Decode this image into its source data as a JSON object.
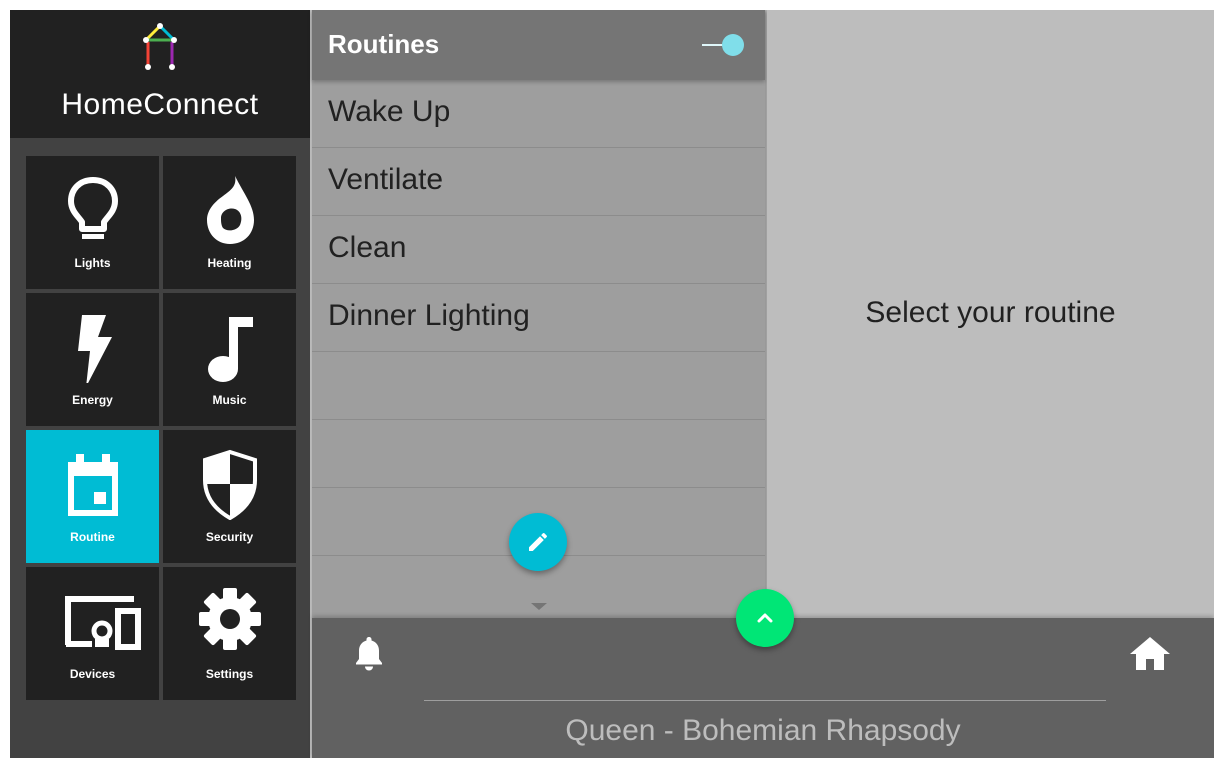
{
  "app": {
    "name": "HomeConnect"
  },
  "sidebar": {
    "tiles": [
      {
        "label": "Lights",
        "icon": "lightbulb-icon"
      },
      {
        "label": "Heating",
        "icon": "flame-icon"
      },
      {
        "label": "Energy",
        "icon": "lightning-bolt-icon"
      },
      {
        "label": "Music",
        "icon": "music-note-icon"
      },
      {
        "label": "Routine",
        "icon": "calendar-icon",
        "active": true
      },
      {
        "label": "Security",
        "icon": "shield-icon"
      },
      {
        "label": "Devices",
        "icon": "devices-icon"
      },
      {
        "label": "Settings",
        "icon": "gear-icon"
      }
    ]
  },
  "routines": {
    "title": "Routines",
    "toggle_on": true,
    "items": [
      "Wake Up",
      "Ventilate",
      "Clean",
      "Dinner Lighting",
      "",
      "",
      ""
    ]
  },
  "detail": {
    "placeholder": "Select your routine"
  },
  "bottom_bar": {
    "now_playing": "Queen - Bohemian Rhapsody"
  },
  "colors": {
    "accent": "#00bcd4",
    "fab_green": "#00e676",
    "sidebar_bg": "#424242",
    "tile_bg": "#212121",
    "list_bg": "#9e9e9e",
    "header_bg": "#757575",
    "bottom_bar_bg": "#616161",
    "detail_bg": "#bdbdbd"
  }
}
